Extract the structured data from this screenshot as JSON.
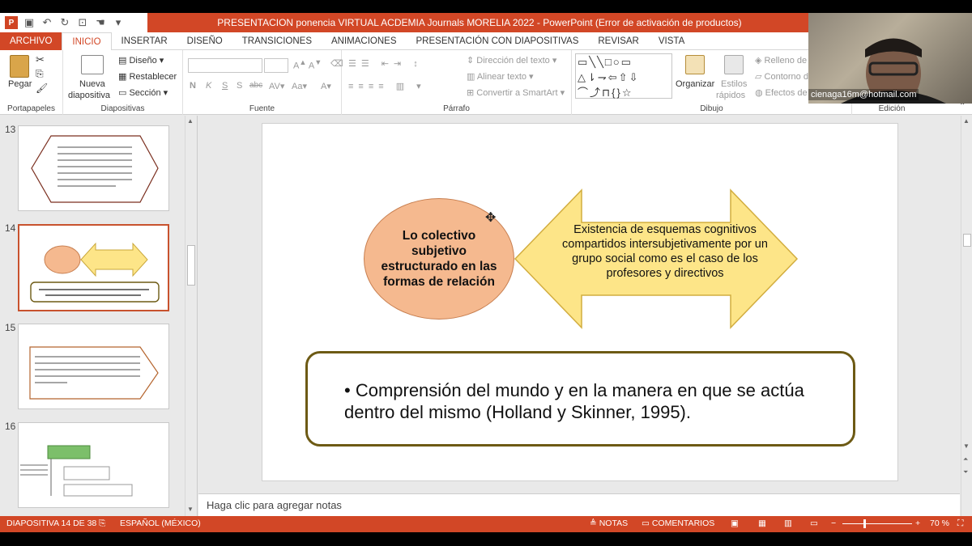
{
  "window": {
    "title": "PRESENTACION ponencia VIRTUAL ACDEMIA  Journals MORELIA 2022 -  PowerPoint (Error de activación de productos)",
    "app_logo": "P"
  },
  "menu": {
    "tabs": [
      "ARCHIVO",
      "INICIO",
      "INSERTAR",
      "DISEÑO",
      "TRANSICIONES",
      "ANIMACIONES",
      "PRESENTACIÓN CON DIAPOSITIVAS",
      "REVISAR",
      "VISTA"
    ]
  },
  "ribbon": {
    "portapapeles": {
      "label": "Portapapeles",
      "paste": "Pegar"
    },
    "diapositivas": {
      "label": "Diapositivas",
      "new_slide_1": "Nueva",
      "new_slide_2": "diapositiva",
      "design": "Diseño",
      "reset": "Restablecer",
      "section": "Sección"
    },
    "fuente": {
      "label": "Fuente",
      "bold": "N",
      "italic": "K",
      "underline": "S",
      "shadow": "S",
      "strike": "abc"
    },
    "parrafo": {
      "label": "Párrafo",
      "text_direction": "Dirección del texto",
      "align_text": "Alinear texto",
      "smartart": "Convertir a SmartArt"
    },
    "dibujo": {
      "label": "Dibujo",
      "arrange": "Organizar",
      "quick_styles_1": "Estilos",
      "quick_styles_2": "rápidos",
      "fill": "Relleno de",
      "outline": "Contorno d",
      "effects": "Efectos de"
    },
    "edicion": {
      "label": "Edición"
    }
  },
  "webcam": {
    "email": "cienaga16m@hotmail.com"
  },
  "thumbnails": [
    {
      "number": "13"
    },
    {
      "number": "14"
    },
    {
      "number": "15"
    },
    {
      "number": "16"
    }
  ],
  "slide": {
    "ellipse_text": "Lo colectivo subjetivo estructurado en las formas de relación",
    "arrow_text": "Existencia de esquemas cognitivos compartidos intersubjetivamente por un grupo social como es el caso de los profesores y directivos",
    "bullet": "• Comprensión del mundo y en la manera en que se actúa dentro del mismo (Holland y Skinner, 1995).",
    "colors": {
      "ellipse": "#f5b98f",
      "arrow": "#fde588",
      "box_border": "#6d5a14"
    }
  },
  "notes": {
    "placeholder": "Haga clic para agregar notas"
  },
  "status": {
    "slide_counter": "DIAPOSITIVA 14 DE 38",
    "language": "ESPAÑOL (MÉXICO)",
    "notes": "NOTAS",
    "comments": "COMENTARIOS",
    "zoom": "70 %"
  }
}
